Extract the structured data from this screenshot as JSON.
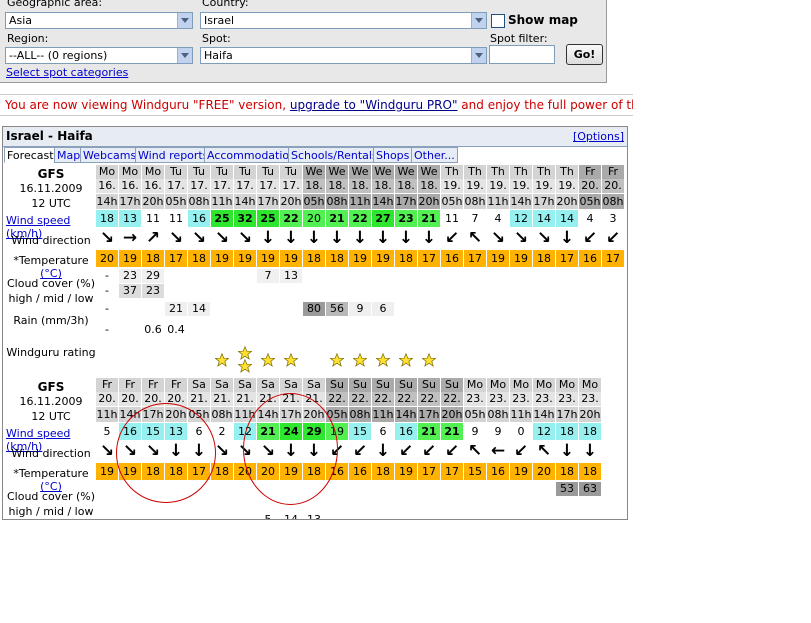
{
  "filters": {
    "geo_label": "Geographic area:",
    "geo_value": "Asia",
    "country_label": "Country:",
    "country_value": "Israel",
    "region_label": "Region:",
    "region_value": "--ALL-- (0 regions)",
    "spot_label": "Spot:",
    "spot_value": "Haifa",
    "show_map": "Show map",
    "spot_filter_label": "Spot filter:",
    "go": "Go!",
    "categories_link": "Select spot categories"
  },
  "banner": {
    "pre": "You are now viewing Windguru \"FREE\" version, ",
    "link": "upgrade to \"Windguru PRO\"",
    "post": " and enjoy the full power of this website"
  },
  "forecast": {
    "title": "Israel - Haifa",
    "options": "[Options]",
    "tabs": [
      "Forecast",
      "Map",
      "Webcams",
      "Wind reports",
      "Accommodation",
      "Schools/Rentals",
      "Shops",
      "Other..."
    ],
    "colors": {
      "temp": "#ffb300",
      "wind_low": "#ffffff",
      "wind_mid": "#9cf3f3",
      "wind_high": "#5df25d",
      "wind_top": "#3ee63e"
    },
    "labels": {
      "model": "GFS",
      "init_date": "16.11.2009",
      "init_time": "12 UTC",
      "wind_speed": "Wind speed",
      "kmh": "(km/h)",
      "wind_dir": "Wind direction",
      "temperature": "*Temperature",
      "degc": "(°C)",
      "cloud1": "Cloud cover (%)",
      "cloud2": "high / mid / low",
      "rain": "Rain (mm/3h)",
      "rating": "Windguru rating"
    },
    "block1": {
      "days": [
        "Mo",
        "Mo",
        "Mo",
        "Tu",
        "Tu",
        "Tu",
        "Tu",
        "Tu",
        "Tu",
        "We",
        "We",
        "We",
        "We",
        "We",
        "We",
        "Th",
        "Th",
        "Th",
        "Th",
        "Th",
        "Th",
        "Fr",
        "Fr"
      ],
      "dates": [
        "16.",
        "16.",
        "16.",
        "17.",
        "17.",
        "17.",
        "17.",
        "17.",
        "17.",
        "18.",
        "18.",
        "18.",
        "18.",
        "18.",
        "18.",
        "19.",
        "19.",
        "19.",
        "19.",
        "19.",
        "19.",
        "20.",
        "20."
      ],
      "hours": [
        "14h",
        "17h",
        "20h",
        "05h",
        "08h",
        "11h",
        "14h",
        "17h",
        "20h",
        "05h",
        "08h",
        "11h",
        "14h",
        "17h",
        "20h",
        "05h",
        "08h",
        "11h",
        "14h",
        "17h",
        "20h",
        "05h",
        "08h"
      ],
      "speed": [
        "18",
        "13",
        "11",
        "11",
        "16",
        "25",
        "32",
        "25",
        "22",
        "20",
        "21",
        "22",
        "27",
        "23",
        "21",
        "11",
        "7",
        "4",
        "12",
        "14",
        "14",
        "4",
        "3"
      ],
      "dir": [
        "↘",
        "→",
        "↗",
        "↘",
        "↘",
        "↘",
        "↘",
        "↓",
        "↓",
        "↓",
        "↓",
        "↓",
        "↓",
        "↓",
        "↓",
        "↙",
        "↖",
        "↘",
        "↘",
        "↘",
        "↓",
        "↙",
        "↙"
      ],
      "temp": [
        "20",
        "19",
        "18",
        "17",
        "18",
        "19",
        "19",
        "19",
        "19",
        "18",
        "18",
        "19",
        "19",
        "18",
        "17",
        "16",
        "17",
        "19",
        "19",
        "18",
        "17",
        "16",
        "17"
      ],
      "cloud_high": [
        "-",
        "23",
        "29",
        "",
        "",
        "",
        "",
        "7",
        "13",
        "",
        "",
        "",
        "",
        "",
        "",
        "",
        "",
        "",
        "",
        "",
        "",
        "",
        ""
      ],
      "cloud_mid": [
        "-",
        "37",
        "23",
        "",
        "",
        "",
        "",
        "",
        "",
        "",
        "",
        "",
        "",
        "",
        "",
        "",
        "",
        "",
        "",
        "",
        "",
        "",
        ""
      ],
      "cloud_low": [
        "-",
        "",
        "",
        "21",
        "14",
        "",
        "",
        "",
        "",
        "80",
        "56",
        "9",
        "6",
        "",
        "",
        "",
        "",
        "",
        "",
        "",
        "",
        "",
        ""
      ],
      "rain": [
        "-",
        "",
        "0.6",
        "0.4",
        "",
        "",
        "",
        "",
        "",
        "",
        "",
        "",
        "",
        "",
        "",
        "",
        "",
        "",
        "",
        "",
        "",
        "",
        ""
      ],
      "rating": [
        0,
        0,
        0,
        0,
        0,
        1,
        2,
        1,
        1,
        0,
        1,
        1,
        1,
        1,
        1,
        0,
        0,
        0,
        0,
        0,
        0,
        0,
        0
      ]
    },
    "block2": {
      "days": [
        "Fr",
        "Fr",
        "Fr",
        "Fr",
        "Sa",
        "Sa",
        "Sa",
        "Sa",
        "Sa",
        "Sa",
        "Su",
        "Su",
        "Su",
        "Su",
        "Su",
        "Su",
        "Mo",
        "Mo",
        "Mo",
        "Mo",
        "Mo",
        "Mo"
      ],
      "dates": [
        "20.",
        "20.",
        "20.",
        "20.",
        "21.",
        "21.",
        "21.",
        "21.",
        "21.",
        "21.",
        "22.",
        "22.",
        "22.",
        "22.",
        "22.",
        "22.",
        "23.",
        "23.",
        "23.",
        "23.",
        "23.",
        "23."
      ],
      "hours": [
        "11h",
        "14h",
        "17h",
        "20h",
        "05h",
        "08h",
        "11h",
        "14h",
        "17h",
        "20h",
        "05h",
        "08h",
        "11h",
        "14h",
        "17h",
        "20h",
        "05h",
        "08h",
        "11h",
        "14h",
        "17h",
        "20h"
      ],
      "speed": [
        "5",
        "16",
        "15",
        "13",
        "6",
        "2",
        "12",
        "21",
        "24",
        "29",
        "19",
        "15",
        "6",
        "16",
        "21",
        "21",
        "9",
        "9",
        "0",
        "12",
        "18",
        "18"
      ],
      "dir": [
        "↘",
        "↘",
        "↘",
        "↓",
        "↓",
        "↘",
        "↘",
        "↘",
        "↓",
        "↓",
        "↙",
        "↙",
        "↓",
        "↙",
        "↙",
        "↙",
        "↖",
        "←",
        "↙",
        "↖",
        "↓",
        "↓"
      ],
      "temp": [
        "19",
        "19",
        "18",
        "18",
        "17",
        "18",
        "20",
        "20",
        "19",
        "18",
        "16",
        "16",
        "18",
        "19",
        "17",
        "17",
        "15",
        "16",
        "19",
        "20",
        "18",
        "18"
      ],
      "cloud_low": [
        "",
        "",
        "",
        "",
        "",
        "",
        "",
        "",
        "",
        "",
        "",
        "",
        "",
        "",
        "",
        "",
        "",
        "",
        "",
        "",
        "53",
        "63"
      ],
      "partial": [
        "",
        "",
        "",
        "",
        "",
        "",
        "",
        "5",
        "14",
        "13",
        "",
        "",
        "",
        "",
        "",
        "",
        "",
        "",
        "",
        "",
        "",
        ""
      ]
    }
  }
}
